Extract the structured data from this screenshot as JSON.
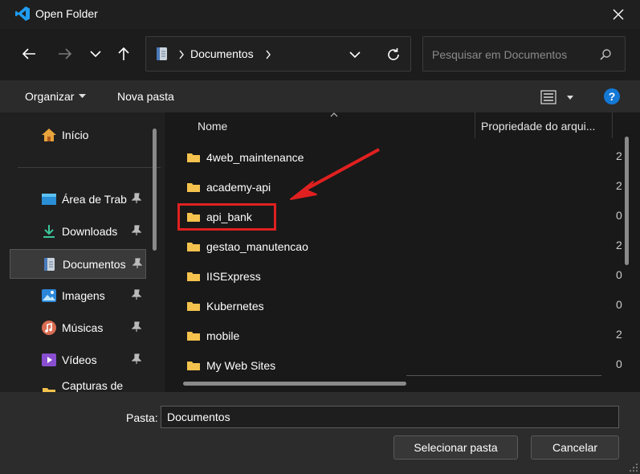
{
  "window": {
    "title": "Open Folder"
  },
  "address": {
    "path": "Documentos"
  },
  "search": {
    "placeholder": "Pesquisar em Documentos"
  },
  "commandbar": {
    "organize": "Organizar",
    "new_folder": "Nova pasta"
  },
  "sidebar": {
    "items": [
      {
        "label": "Início",
        "icon": "home-icon"
      },
      {
        "label": "Área de Trab",
        "icon": "desktop-icon",
        "pinned": true
      },
      {
        "label": "Downloads",
        "icon": "download-icon",
        "pinned": true
      },
      {
        "label": "Documentos",
        "icon": "document-icon",
        "pinned": true,
        "selected": true
      },
      {
        "label": "Imagens",
        "icon": "pictures-icon",
        "pinned": true
      },
      {
        "label": "Músicas",
        "icon": "music-icon",
        "pinned": true
      },
      {
        "label": "Vídeos",
        "icon": "video-icon",
        "pinned": true
      },
      {
        "label": "Capturas de Tela",
        "icon": "folder-icon"
      }
    ]
  },
  "columns": {
    "name": "Nome",
    "property": "Propriedade do arqui..."
  },
  "files": [
    {
      "name": "4web_maintenance",
      "trailing": "2"
    },
    {
      "name": "academy-api",
      "trailing": "2"
    },
    {
      "name": "api_bank",
      "trailing": "0",
      "highlighted": true
    },
    {
      "name": "gestao_manutencao",
      "trailing": "2"
    },
    {
      "name": "IISExpress",
      "trailing": "0"
    },
    {
      "name": "Kubernetes",
      "trailing": "0"
    },
    {
      "name": "mobile",
      "trailing": "2"
    },
    {
      "name": "My Web Sites",
      "trailing": "0"
    }
  ],
  "footer": {
    "folder_label": "Pasta:",
    "folder_value": "Documentos",
    "select_label": "Selecionar pasta",
    "cancel_label": "Cancelar"
  },
  "colors": {
    "accent": "#0078d4",
    "annotation": "#e02020",
    "folder": "#f4c24d"
  }
}
